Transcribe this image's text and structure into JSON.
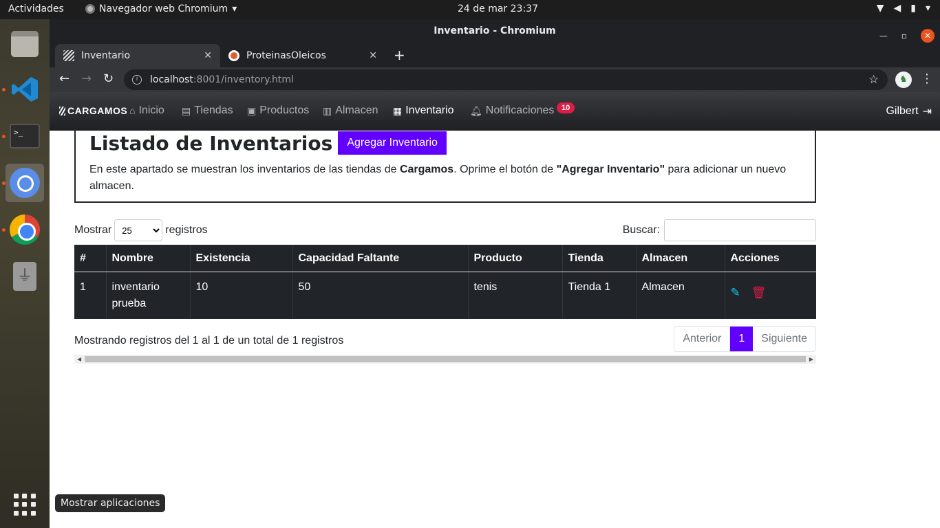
{
  "topbar": {
    "activities": "Actividades",
    "app_menu": "Navegador web Chromium",
    "clock": "24 de mar  23:37"
  },
  "window": {
    "title": "Inventario - Chromium"
  },
  "tabs": [
    {
      "label": "Inventario"
    },
    {
      "label": "ProteinasOleicos"
    }
  ],
  "address": {
    "host": "localhost",
    "path": ":8001/inventory.html"
  },
  "navbar": {
    "brand": "CARGAMOS",
    "links": [
      {
        "label": "Inicio",
        "icon": "home-icon"
      },
      {
        "label": "Tiendas",
        "icon": "store-icon"
      },
      {
        "label": "Productos",
        "icon": "briefcase-icon"
      },
      {
        "label": "Almacen",
        "icon": "warehouse-icon"
      },
      {
        "label": "Inventario",
        "icon": "boxes-icon"
      },
      {
        "label": "Notificaciones",
        "icon": "bell-icon"
      }
    ],
    "notification_count": "10",
    "user": "Gilbert"
  },
  "header": {
    "title": "Listado de Inventarios",
    "add_button": "Agregar Inventario",
    "desc_1": "En este apartado se muestran los inventarios de las tiendas de ",
    "desc_brand": "Cargamos",
    "desc_2": ". Oprime el botón de ",
    "desc_button": "\"Agregar Inventario\"",
    "desc_3": " para adicionar un nuevo almacen."
  },
  "controls": {
    "show_label": "Mostrar",
    "page_size": "25",
    "records_label": "registros",
    "search_label": "Buscar:"
  },
  "table": {
    "columns": [
      "#",
      "Nombre",
      "Existencia",
      "Capacidad Faltante",
      "Producto",
      "Tienda",
      "Almacen",
      "Acciones"
    ],
    "rows": [
      {
        "num": "1",
        "nombre": "inventario prueba",
        "existencia": "10",
        "capacidad": "50",
        "producto": "tenis",
        "tienda": "Tienda 1",
        "almacen": "Almacen"
      }
    ]
  },
  "pagination": {
    "info": "Mostrando registros del 1 al 1 de un total de 1 registros",
    "prev": "Anterior",
    "current": "1",
    "next": "Siguiente"
  },
  "tooltip": "Mostrar aplicaciones",
  "colors": {
    "accent": "#6200ff",
    "danger": "#dc1d45",
    "info": "#0dcaf0",
    "table_bg": "#212529"
  }
}
